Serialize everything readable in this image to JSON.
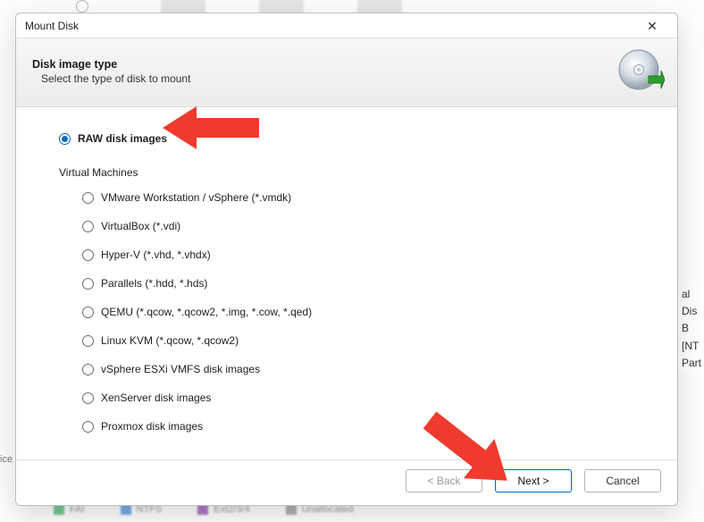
{
  "window": {
    "title": "Mount Disk"
  },
  "header": {
    "heading": "Disk image type",
    "sub": "Select the type of disk to mount"
  },
  "options": {
    "raw": {
      "label": "RAW disk images",
      "selected": true
    },
    "group_heading": "Virtual Machines",
    "vm": [
      {
        "id": "vmware",
        "label": "VMware Workstation / vSphere (*.vmdk)"
      },
      {
        "id": "virtualbox",
        "label": "VirtualBox (*.vdi)"
      },
      {
        "id": "hyperv",
        "label": "Hyper-V (*.vhd, *.vhdx)"
      },
      {
        "id": "parallels",
        "label": "Parallels (*.hdd, *.hds)"
      },
      {
        "id": "qemu",
        "label": "QEMU (*.qcow, *.qcow2, *.img, *.cow, *.qed)"
      },
      {
        "id": "linuxkvm",
        "label": "Linux KVM (*.qcow, *.qcow2)"
      },
      {
        "id": "esxi",
        "label": "vSphere ESXi VMFS disk images"
      },
      {
        "id": "xen",
        "label": "XenServer disk images"
      },
      {
        "id": "proxmox",
        "label": "Proxmox disk images"
      }
    ]
  },
  "footer": {
    "back": "< Back",
    "next": "Next >",
    "cancel": "Cancel"
  },
  "backdrop": {
    "left_label": "ice",
    "right_lines": [
      "al Dis",
      "B [NT",
      "Part"
    ],
    "bottom_chips": [
      {
        "label": "FAI",
        "color": "#1aa34a"
      },
      {
        "label": "NTFS",
        "color": "#1976d2"
      },
      {
        "label": "Ext2/3/4",
        "color": "#7b1fa2"
      },
      {
        "label": "Unallocated",
        "color": "#7a7a7a"
      }
    ]
  },
  "colors": {
    "accent": "#0067c0",
    "arrow": "#f03a2d"
  }
}
